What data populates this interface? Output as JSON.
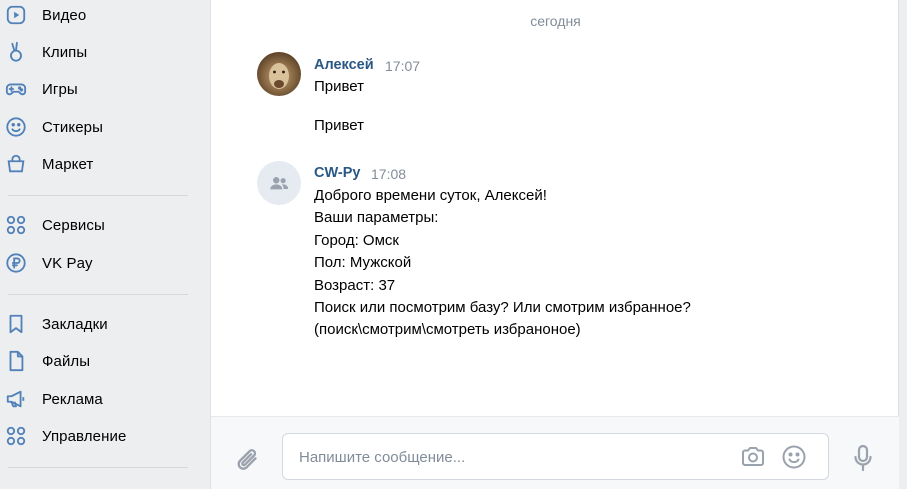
{
  "sidebar": {
    "items": [
      {
        "label": "Видео",
        "icon": "video-icon"
      },
      {
        "label": "Клипы",
        "icon": "clips-icon"
      },
      {
        "label": "Игры",
        "icon": "gamepad-icon"
      },
      {
        "label": "Стикеры",
        "icon": "sticker-icon"
      },
      {
        "label": "Маркет",
        "icon": "market-icon"
      },
      {
        "label": "Сервисы",
        "icon": "services-icon"
      },
      {
        "label": "VK Pay",
        "icon": "vkpay-icon"
      },
      {
        "label": "Закладки",
        "icon": "bookmark-icon"
      },
      {
        "label": "Файлы",
        "icon": "file-icon"
      },
      {
        "label": "Реклама",
        "icon": "megaphone-icon"
      },
      {
        "label": "Управление",
        "icon": "manage-icon"
      }
    ]
  },
  "chat": {
    "date_separator": "сегодня",
    "messages": [
      {
        "author": "Алексей",
        "time": "17:07",
        "lines": [
          "Привет",
          "Привет"
        ]
      },
      {
        "author": "CW-Py",
        "time": "17:08",
        "lines": [
          "Доброго времени суток, Алексей!",
          "Ваши параметры:",
          "Город: Омск",
          "Пол: Мужской",
          "Возраст: 37",
          "Поиск или посмотрим базу? Или смотрим избранное?",
          "(поиск\\смотрим\\смотреть избраноное)"
        ]
      }
    ]
  },
  "composer": {
    "placeholder": "Напишите сообщение...",
    "value": ""
  },
  "colors": {
    "accent": "#5181b8",
    "author": "#2a5885",
    "muted": "#818c99",
    "background": "#edeef0"
  }
}
